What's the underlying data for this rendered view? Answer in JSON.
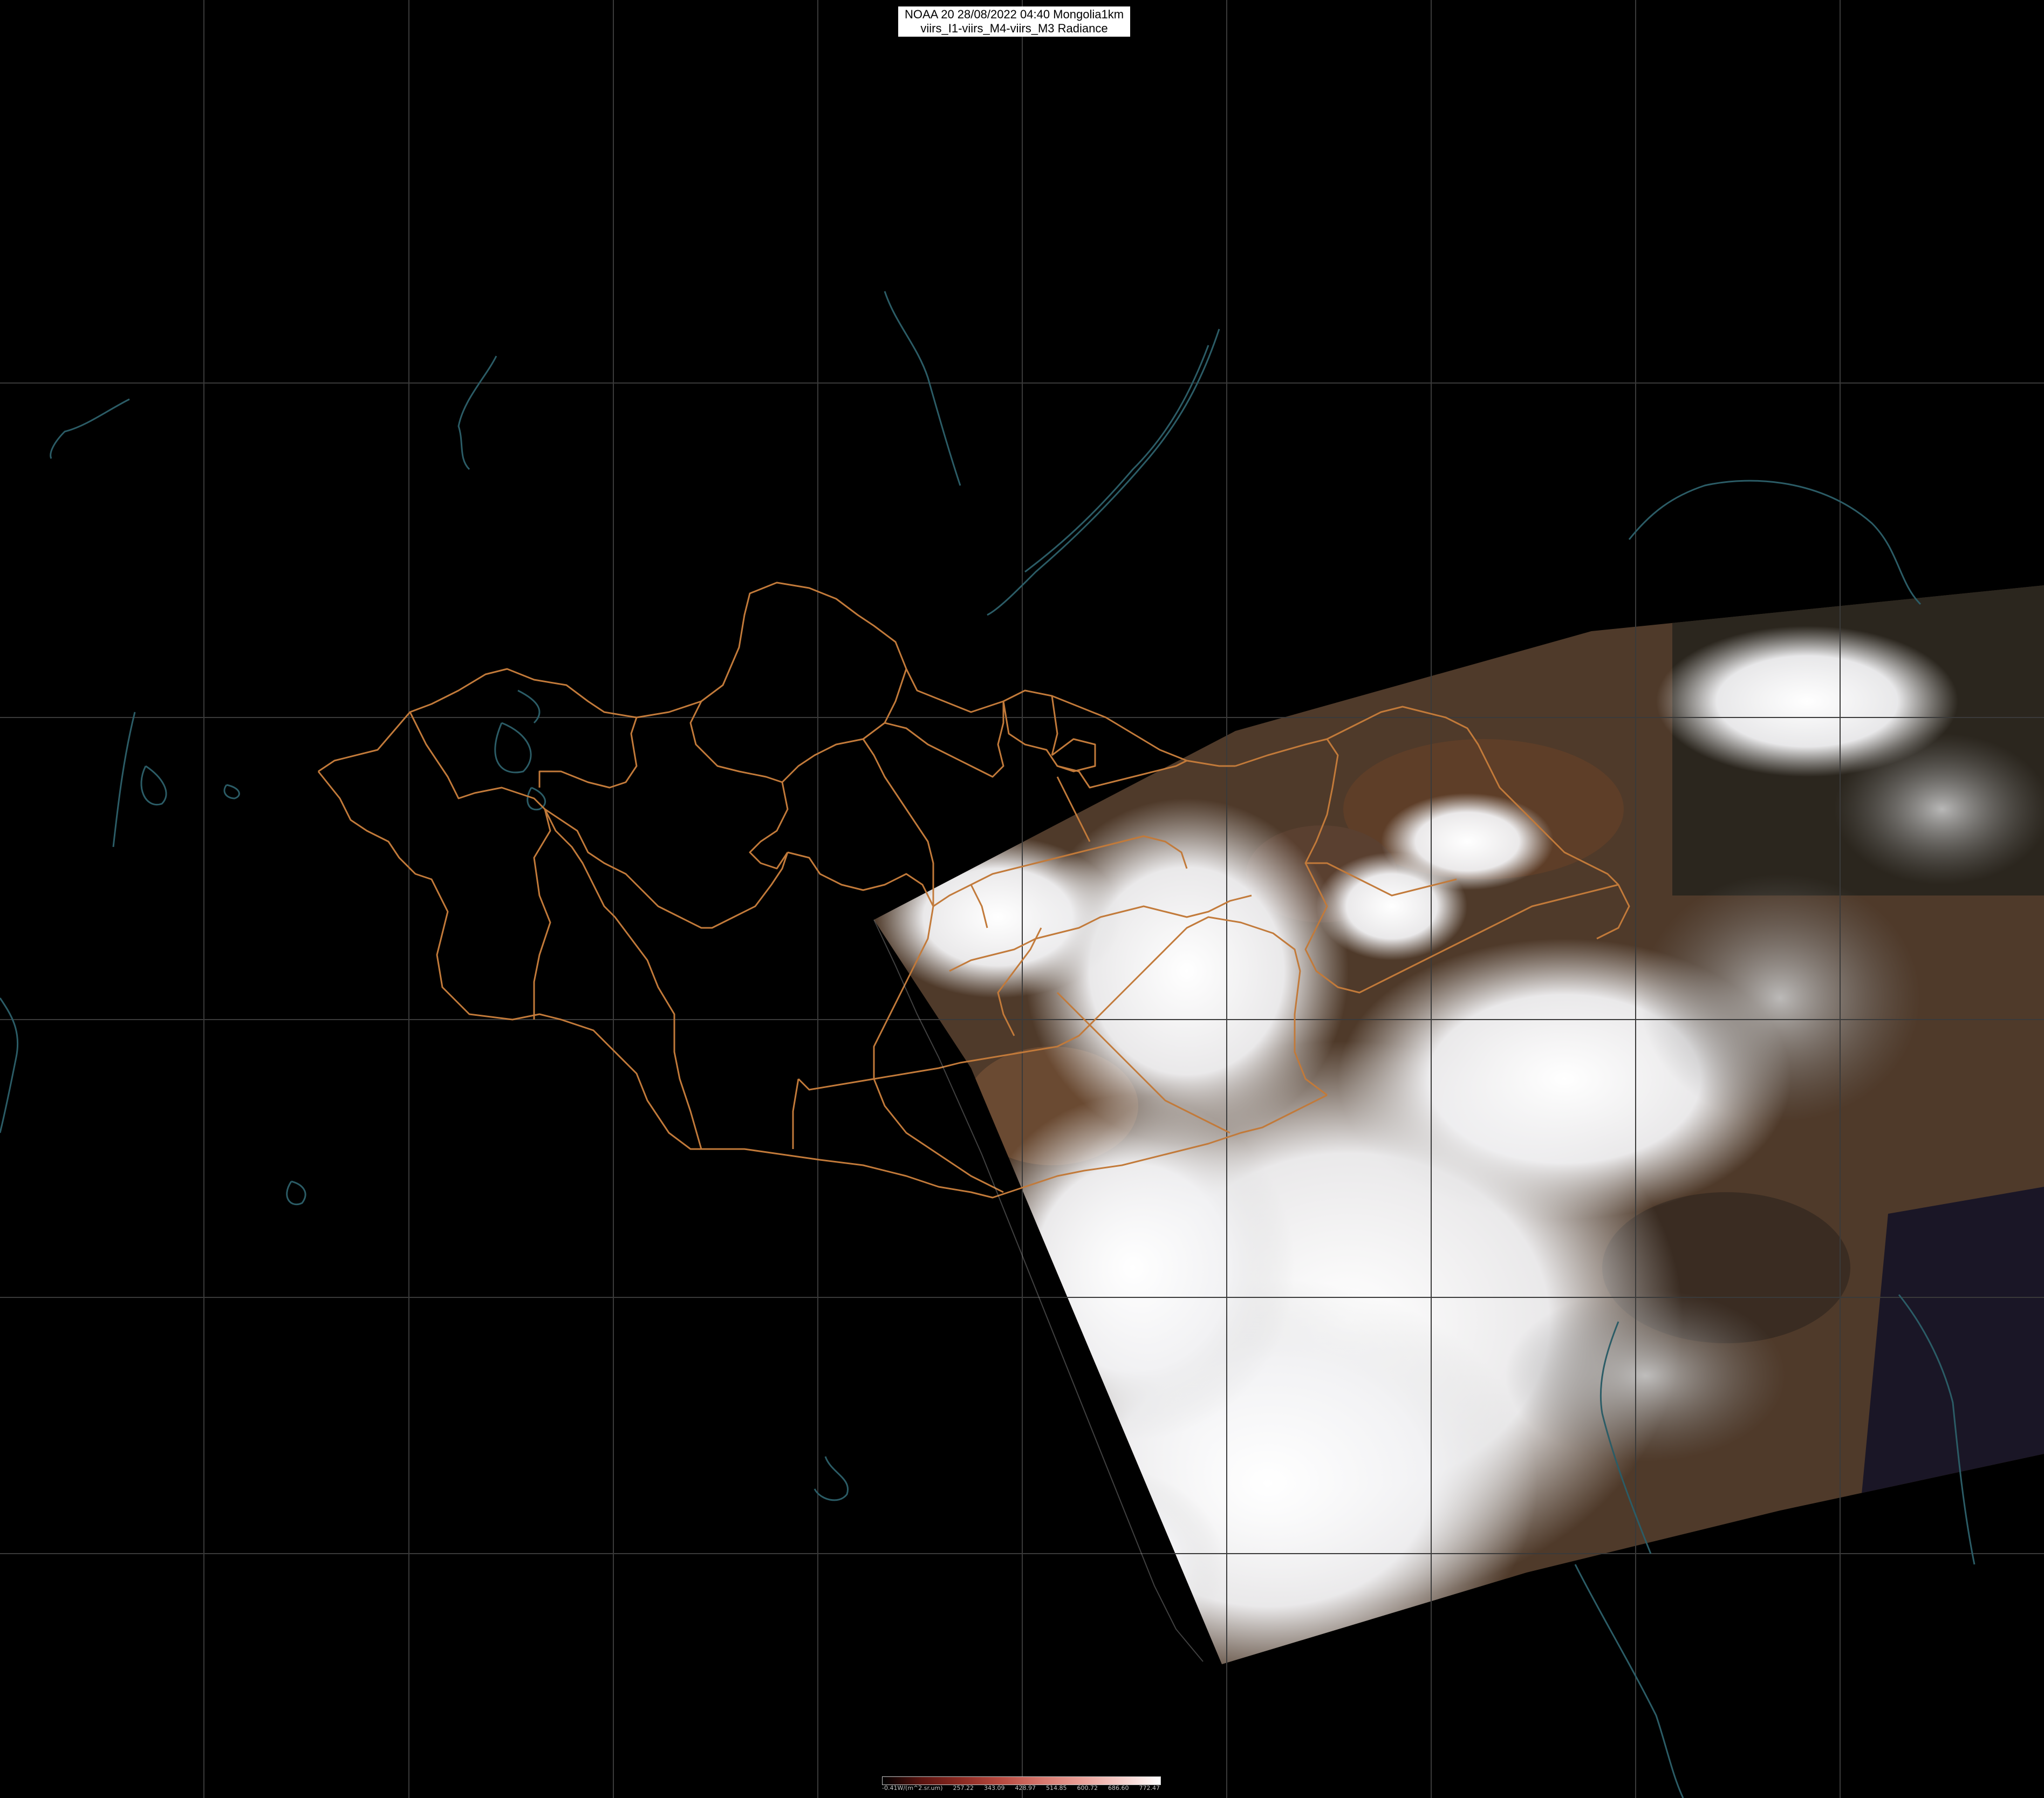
{
  "header": {
    "line1": "NOAA 20 28/08/2022 04:40 Mongolia1km",
    "line2": "viirs_I1-viirs_M4-viirs_M3 Radiance"
  },
  "colorbar": {
    "labels": [
      "-0.41W/(m^2.sr.um)",
      "257.22",
      "343.09",
      "428.97",
      "514.85",
      "600.72",
      "686.60",
      "772.47"
    ],
    "colors": [
      "#000000",
      "#5c1410",
      "#8c2a22",
      "#b84a40",
      "#d6766c",
      "#ea9f97",
      "#f6cdc9",
      "#ffffff"
    ]
  },
  "map": {
    "background_color": "#000000",
    "grid_color": "#3a3a3a",
    "border_color": "#c27a3a",
    "coast_color": "#2b5c66",
    "land_color": "#6a4a30",
    "cloud_color": "#f4f4f6"
  }
}
